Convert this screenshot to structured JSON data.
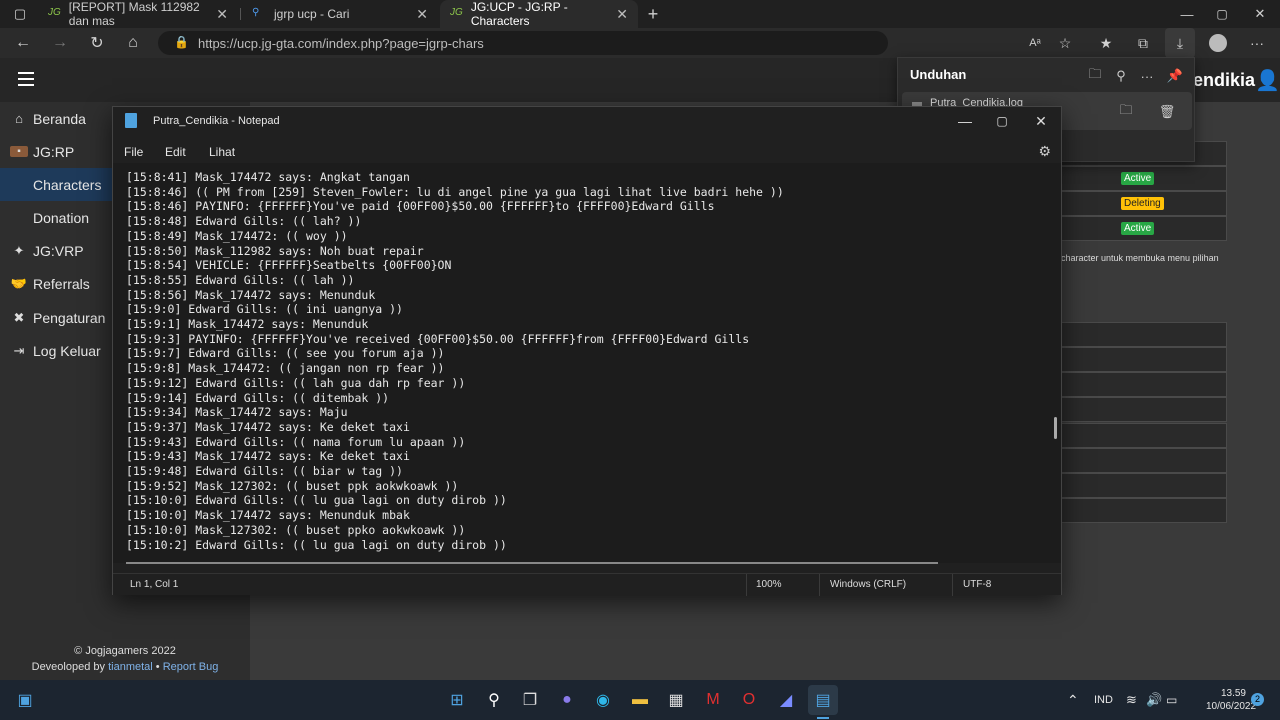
{
  "browser": {
    "tabs": [
      {
        "label": "[REPORT] Mask 112982 dan mas",
        "icon": "JG"
      },
      {
        "label": "jgrp ucp - Cari",
        "icon": "search"
      },
      {
        "label": "JG:UCP - JG:RP - Characters",
        "icon": "JG"
      }
    ],
    "url": "https://ucp.jg-gta.com/index.php?page=jgrp-chars"
  },
  "site": {
    "brand_partial": "endikia",
    "sidebar": [
      {
        "label": "Beranda"
      },
      {
        "label": "JG:RP"
      },
      {
        "label": "Characters"
      },
      {
        "label": "Donation"
      },
      {
        "label": "JG:VRP"
      },
      {
        "label": "Referrals"
      },
      {
        "label": "Pengaturan"
      },
      {
        "label": "Log Keluar"
      }
    ],
    "footer": {
      "copyright": "© Jogjagamers 2022",
      "developed_prefix": "Deveoloped by",
      "developer": "tianmetal",
      "separator": "•",
      "report": "Report Bug"
    },
    "statuses": [
      "Active",
      "Deleting",
      "Active"
    ],
    "hint": "character untuk membuka menu pilihan"
  },
  "downloads": {
    "title": "Unduhan",
    "file": "Putra_Cendikia.log"
  },
  "notepad": {
    "title": "Putra_Cendikia - Notepad",
    "menu": [
      "File",
      "Edit",
      "Lihat"
    ],
    "lines": [
      "[15:8:41] Mask_174472 says: Angkat tangan",
      "[15:8:46] (( PM from [259] Steven_Fowler: lu di angel pine ya gua lagi lihat live badri hehe ))",
      "[15:8:46] PAYINFO: {FFFFFF}You've paid {00FF00}$50.00 {FFFFFF}to {FFFF00}Edward Gills",
      "[15:8:48] Edward Gills: (( lah? ))",
      "[15:8:49] Mask_174472: (( woy ))",
      "[15:8:50] Mask_112982 says: Noh buat repair",
      "[15:8:54] VEHICLE: {FFFFFF}Seatbelts {00FF00}ON",
      "[15:8:55] Edward Gills: (( lah ))",
      "[15:8:56] Mask_174472 says: Menunduk",
      "[15:9:0] Edward Gills: (( ini uangnya ))",
      "[15:9:1] Mask_174472 says: Menunduk",
      "[15:9:3] PAYINFO: {FFFFFF}You've received {00FF00}$50.00 {FFFFFF}from {FFFF00}Edward Gills",
      "[15:9:7] Edward Gills: (( see you forum aja ))",
      "[15:9:8] Mask_174472: (( jangan non rp fear ))",
      "[15:9:12] Edward Gills: (( lah gua dah rp fear ))",
      "[15:9:14] Edward Gills: (( ditembak ))",
      "[15:9:34] Mask_174472 says: Maju",
      "[15:9:37] Mask_174472 says: Ke deket taxi",
      "[15:9:43] Edward Gills: (( nama forum lu apaan ))",
      "[15:9:43] Mask_174472 says: Ke deket taxi",
      "[15:9:48] Edward Gills: (( biar w tag ))",
      "[15:9:52] Mask_127302: (( buset ppk aokwkoawk ))",
      "[15:10:0] Edward Gills: (( lu gua lagi on duty dirob ))",
      "[15:10:0] Mask_174472 says: Menunduk mbak",
      "[15:10:0] Mask_127302: (( buset ppko aokwkoawk ))",
      "[15:10:2] Edward Gills: (( lu gua lagi on duty dirob ))"
    ],
    "status": {
      "position": "Ln 1, Col 1",
      "zoom": "100%",
      "eol": "Windows (CRLF)",
      "encoding": "UTF-8"
    }
  },
  "taskbar": {
    "language": "IND",
    "time": "13.59",
    "date": "10/06/2022",
    "notifications": "2"
  }
}
